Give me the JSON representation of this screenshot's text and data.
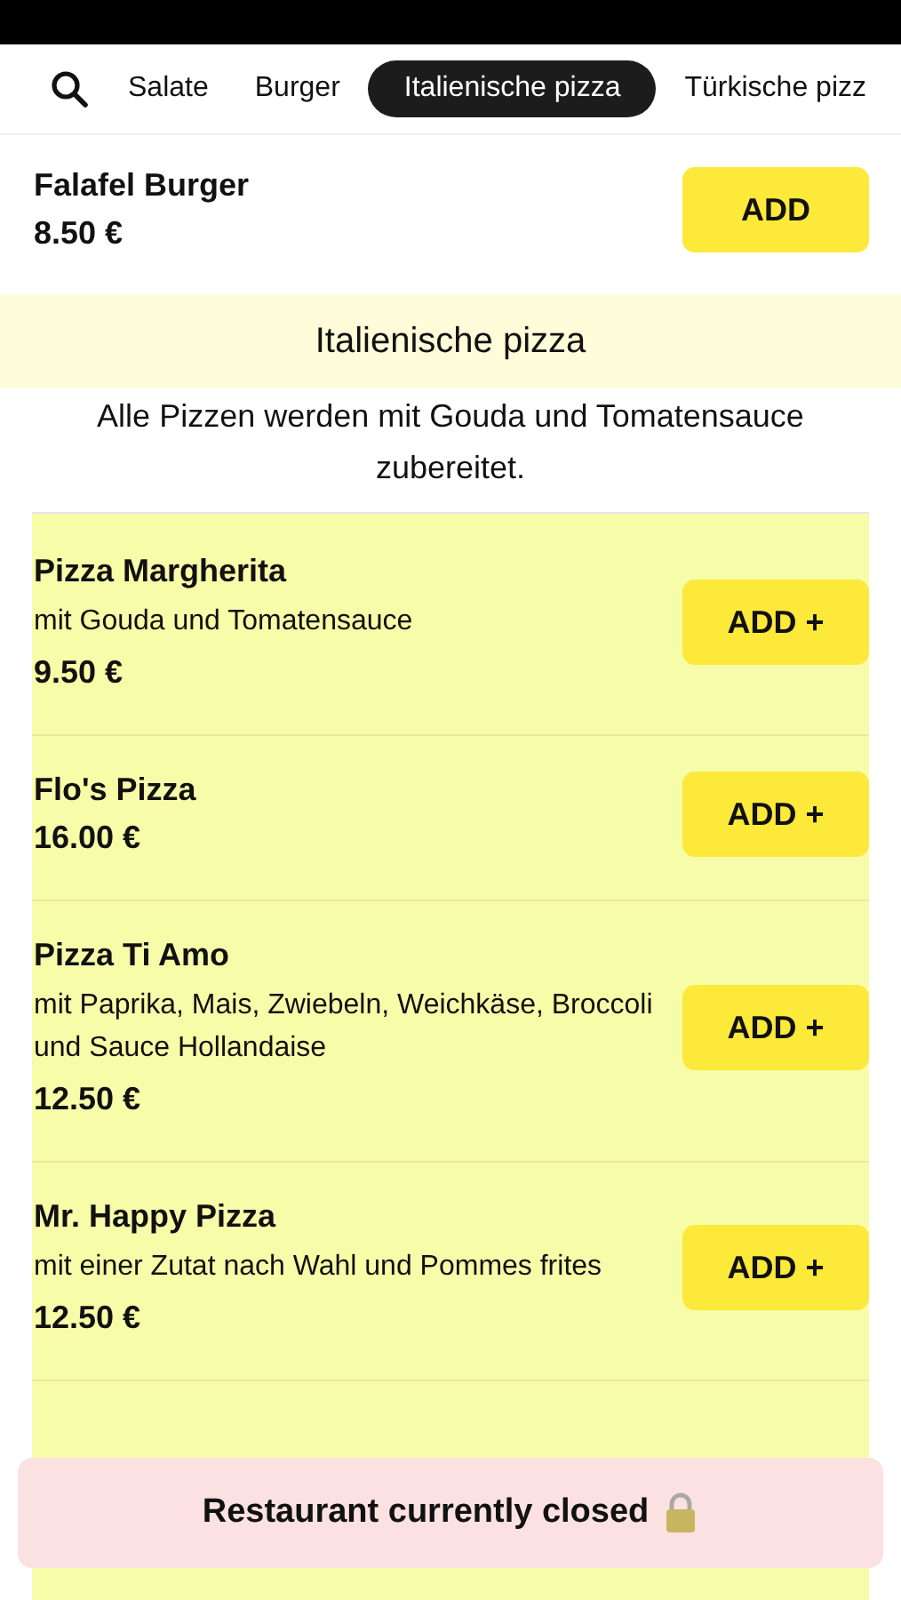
{
  "categories": [
    {
      "label": "Salate",
      "selected": false
    },
    {
      "label": "Burger",
      "selected": false
    },
    {
      "label": "Italienische pizza",
      "selected": true
    },
    {
      "label": "Türkische pizz",
      "selected": false
    }
  ],
  "previous_item": {
    "name": "Falafel Burger",
    "price": "8.50 €",
    "button": "ADD"
  },
  "section": {
    "title": "Italienische pizza",
    "description": "Alle Pizzen werden mit Gouda und Tomatensauce zubereitet."
  },
  "items": [
    {
      "name": "Pizza Margherita",
      "description": "mit Gouda und Tomatensauce",
      "price": "9.50 €",
      "button": "ADD +"
    },
    {
      "name": "Flo's Pizza",
      "price": "16.00 €",
      "button": "ADD +"
    },
    {
      "name": "Pizza Ti Amo",
      "description": "mit Paprika, Mais, Zwiebeln, Weichkäse, Broccoli und Sauce Hollandaise",
      "price": "12.50 €",
      "button": "ADD +"
    },
    {
      "name": "Mr. Happy Pizza",
      "description": "mit einer Zutat nach Wahl und Pommes frites",
      "price": "12.50 €",
      "button": "ADD +"
    }
  ],
  "notice": {
    "text": "Restaurant currently closed"
  }
}
